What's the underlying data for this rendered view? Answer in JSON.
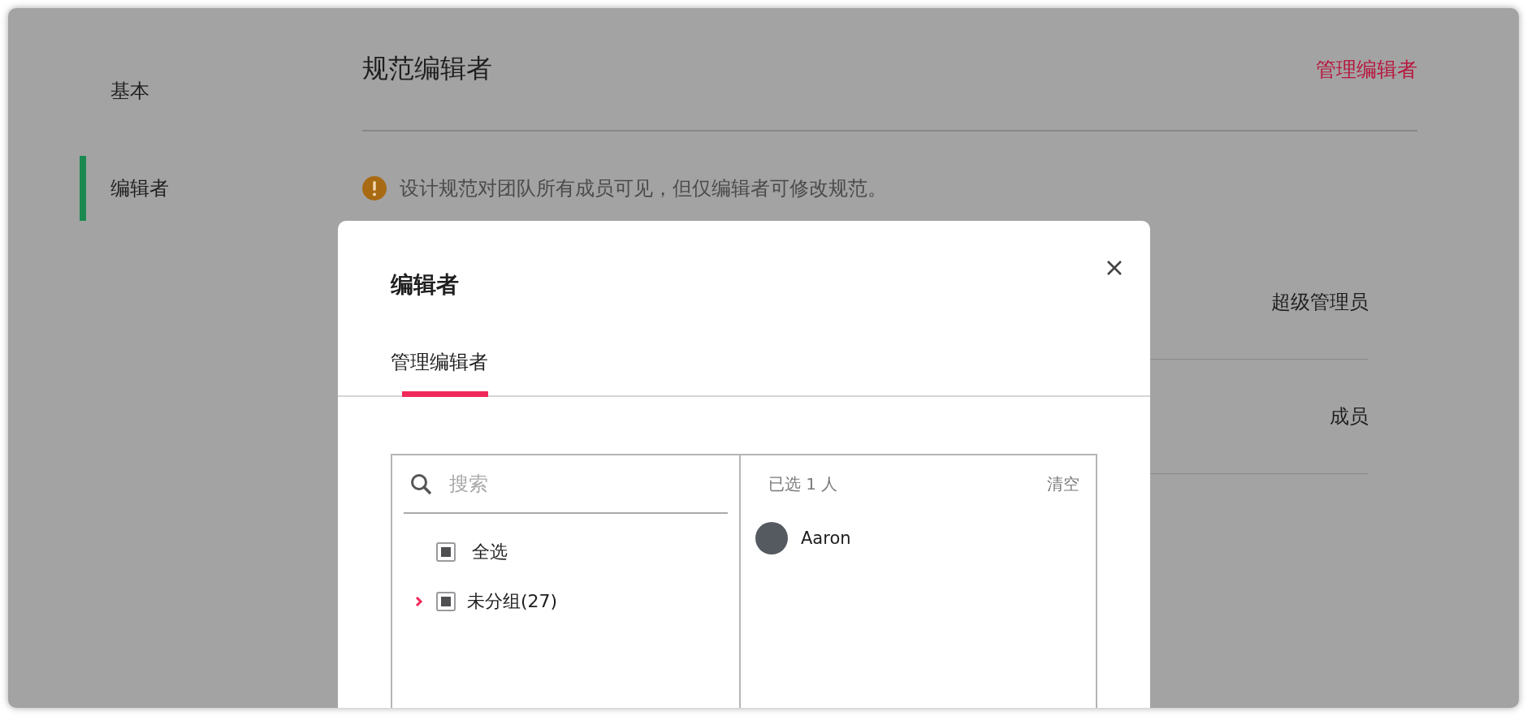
{
  "sidebar": {
    "items": [
      {
        "label": "基本",
        "selected": false
      },
      {
        "label": "编辑者",
        "selected": true
      }
    ]
  },
  "main": {
    "title": "规范编辑者",
    "action_link": "管理编辑者",
    "notice": "设计规范对团队所有成员可见，但仅编辑者可修改规范。",
    "roles": [
      {
        "label": "超级管理员"
      },
      {
        "label": "成员"
      }
    ]
  },
  "dialog": {
    "title": "编辑者",
    "tabs": [
      {
        "label": "管理编辑者",
        "selected": true
      }
    ],
    "search": {
      "placeholder": "搜索"
    },
    "select_all": {
      "label": "全选",
      "checked": false,
      "indeterminate": true
    },
    "groups": [
      {
        "label": "未分组(27)",
        "checked": false,
        "indeterminate": true,
        "expanded": false
      }
    ],
    "selected_panel": {
      "summary": "已选 1 人",
      "clear": "清空",
      "people": [
        {
          "name": "Aaron"
        }
      ]
    }
  }
}
